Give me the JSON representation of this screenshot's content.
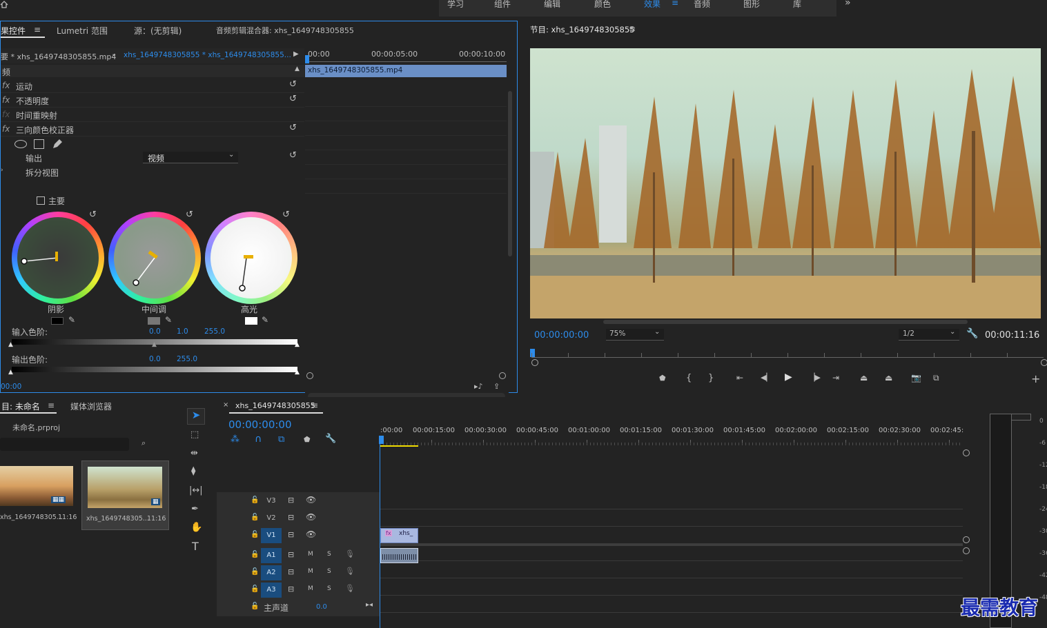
{
  "workspaces": {
    "items": [
      "学习",
      "组件",
      "编辑",
      "颜色",
      "效果",
      "音频",
      "图形",
      "库"
    ],
    "active": "效果",
    "more": "»"
  },
  "effect_controls": {
    "tabs": [
      "果控件",
      "Lumetri 范围",
      "源：(无剪辑)",
      "音频剪辑混合器: xhs_1649748305855"
    ],
    "source_label": "要 * xhs_1649748305855.mp4",
    "sequence_dropdown": "xhs_1649748305855 * xhs_1649748305855...",
    "timecodes": [
      "00:00",
      "00:00:05:00",
      "00:00:10:00"
    ],
    "clip_name": "xhs_1649748305855.mp4",
    "section": "频",
    "effects": [
      "运动",
      "不透明度",
      "时间重映射",
      "三向颜色校正器"
    ],
    "output_label": "输出",
    "output_value": "视频",
    "split_label": "拆分视图",
    "master_label": "主要",
    "wheels": [
      "阴影",
      "中间调",
      "高光"
    ],
    "input_levels_label": "输入色阶:",
    "input_levels": [
      "0.0",
      "1.0",
      "255.0"
    ],
    "output_levels_label": "输出色阶:",
    "output_levels": [
      "0.0",
      "255.0"
    ],
    "bottom_timecode": "00:00"
  },
  "program": {
    "title": "节目: xhs_1649748305855",
    "current_time": "00:00:00:00",
    "zoom": "75%",
    "resolution": "1/2",
    "duration": "00:00:11:16",
    "add_button": "+"
  },
  "project": {
    "tabs": [
      "目: 未命名",
      "媒体浏览器"
    ],
    "file": "未命名.prproj",
    "items": [
      {
        "name": "xhs_1649748305...",
        "duration": "11:16"
      },
      {
        "name": "xhs_1649748305...",
        "duration": "11:16"
      }
    ]
  },
  "timeline": {
    "tab": "xhs_1649748305855",
    "timecode": "00:00:00:00",
    "ruler": [
      ":00:00",
      "00:00:15:00",
      "00:00:30:00",
      "00:00:45:00",
      "00:01:00:00",
      "00:01:15:00",
      "00:01:30:00",
      "00:01:45:00",
      "00:02:00:00",
      "00:02:15:00",
      "00:02:30:00",
      "00:02:45:"
    ],
    "video_tracks": [
      "V3",
      "V2",
      "V1"
    ],
    "audio_tracks": [
      "A1",
      "A2",
      "A3"
    ],
    "audio_buttons": [
      "M",
      "S"
    ],
    "master_label": "主声道",
    "master_value": "0.0",
    "clip_label": "xhs_",
    "fx_badge": "fx"
  },
  "meter": {
    "labels": [
      "0",
      "-6",
      "-12",
      "-18",
      "-24",
      "-30",
      "-36",
      "-42",
      "-48"
    ]
  },
  "watermark": "最需教育",
  "colors": {
    "accent": "#2d8ceb",
    "panel": "#262626",
    "clip_blue": "#6a8fc6",
    "track_blue": "#1a4d7f"
  }
}
